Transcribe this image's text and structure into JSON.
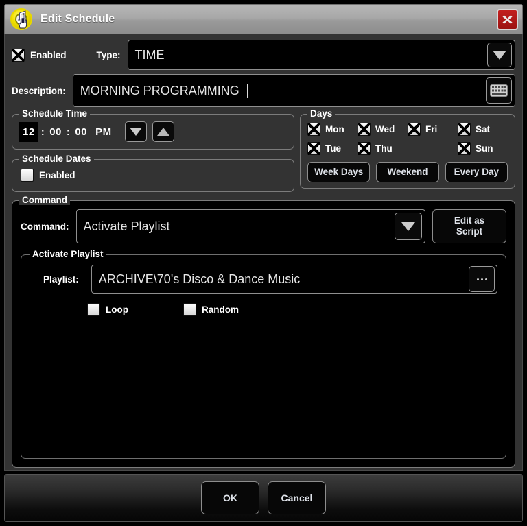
{
  "window": {
    "title": "Edit Schedule",
    "icon": "music-note-hand-icon",
    "close_label": "✕"
  },
  "header": {
    "enabled_label": "Enabled",
    "enabled_checked": true,
    "type_label": "Type:",
    "type_value": "TIME",
    "type_dropdown_icon": "chevron-down-icon"
  },
  "description": {
    "label": "Description:",
    "value": "MORNING PROGRAMMING",
    "keyboard_icon": "keyboard-icon"
  },
  "schedule_time": {
    "title": "Schedule Time",
    "hour": "12",
    "sep1": ":",
    "minute": "00",
    "sep2": ":",
    "second": "00",
    "meridiem": "PM",
    "down_icon": "triangle-down-icon",
    "up_icon": "triangle-up-icon"
  },
  "schedule_dates": {
    "title": "Schedule Dates",
    "enabled_label": "Enabled",
    "enabled_checked": false
  },
  "days": {
    "title": "Days",
    "items": [
      {
        "label": "Mon",
        "checked": true
      },
      {
        "label": "Wed",
        "checked": true
      },
      {
        "label": "Fri",
        "checked": true
      },
      {
        "label": "Sat",
        "checked": true
      },
      {
        "label": "Tue",
        "checked": true
      },
      {
        "label": "Thu",
        "checked": true
      },
      {
        "label": "",
        "checked": false
      },
      {
        "label": "Sun",
        "checked": true
      }
    ],
    "buttons": [
      {
        "label": "Week Days"
      },
      {
        "label": "Weekend"
      },
      {
        "label": "Every Day"
      }
    ]
  },
  "command": {
    "title": "Command",
    "label": "Command:",
    "value": "Activate Playlist",
    "dropdown_icon": "chevron-down-icon",
    "edit_as_script_line1": "Edit as",
    "edit_as_script_line2": "Script"
  },
  "activate_playlist": {
    "title": "Activate Playlist",
    "playlist_label": "Playlist:",
    "playlist_value": "ARCHIVE\\70's Disco & Dance Music",
    "browse_label": "...",
    "loop_label": "Loop",
    "loop_checked": false,
    "random_label": "Random",
    "random_checked": false
  },
  "footer": {
    "ok_label": "OK",
    "cancel_label": "Cancel"
  },
  "colors": {
    "titlebar": "#a8a8a8",
    "body_bg": "#333333",
    "panel_bg": "#000000",
    "close_red": "#b01b1a",
    "accent_text": "#ffffff",
    "icon_yellow": "#f5e400"
  }
}
